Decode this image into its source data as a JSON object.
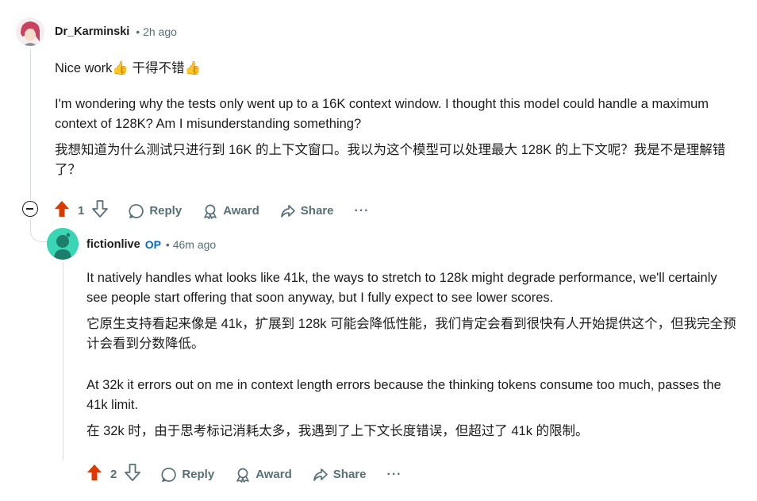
{
  "comment1": {
    "author": "Dr_Karminski",
    "time": "2h ago",
    "line1": "Nice work👍   干得不错👍",
    "para_en": "I'm wondering why the tests only went up to a 16K context window. I thought this model could handle a maximum context of 128K? Am I misunderstanding something?",
    "para_zh": "我想知道为什么测试只进行到 16K 的上下文窗口。我以为这个模型可以处理最大 128K 的上下文呢？我是不是理解错了？",
    "votes": "1",
    "reply": "Reply",
    "award": "Award",
    "share": "Share",
    "more": "···"
  },
  "comment2": {
    "author": "fictionlive",
    "op_badge": "OP",
    "time": "46m ago",
    "para1_en": "It natively handles what looks like 41k, the ways to stretch to 128k might degrade performance, we'll certainly see people start offering that soon anyway, but I fully expect to see lower scores.",
    "para1_zh": "它原生支持看起来像是 41k，扩展到 128k 可能会降低性能，我们肯定会看到很快有人开始提供这个，但我完全预计会看到分数降低。",
    "para2_en": "At 32k it errors out on me in context length errors because the thinking tokens consume too much, passes the 41k limit.",
    "para2_zh": "在 32k 时，由于思考标记消耗太多，我遇到了上下文长度错误，但超过了 41k 的限制。",
    "votes": "2",
    "reply": "Reply",
    "award": "Award",
    "share": "Share",
    "more": "···"
  }
}
